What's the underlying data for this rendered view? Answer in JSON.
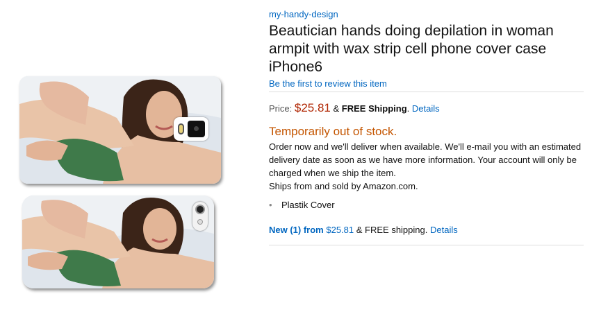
{
  "images": [
    {
      "name": "phone-case-galaxy",
      "camera": "square-camera"
    },
    {
      "name": "phone-case-iphone6",
      "camera": "round-camera"
    }
  ],
  "product": {
    "brand": "my-handy-design",
    "title": "Beautician hands doing depilation in woman armpit with wax strip cell phone cover case iPhone6",
    "review_link": "Be the first to review this item"
  },
  "price": {
    "label": "Price:",
    "value": "$25.81",
    "shipping_prefix": "&",
    "shipping": "FREE Shipping",
    "shipping_suffix": ".",
    "details_link": "Details"
  },
  "availability": {
    "status": "Temporarily out of stock.",
    "message": "Order now and we'll deliver when available. We'll e-mail you with an estimated delivery date as soon as we have more information. Your account will only be charged when we ship the item.",
    "ships_from": "Ships from and sold by Amazon.com."
  },
  "features": [
    {
      "bullet": "•",
      "text": "Plastik Cover"
    }
  ],
  "offers": {
    "label": "New (1) from",
    "price": "$25.81",
    "shipping": "& FREE shipping.",
    "details_link": "Details"
  },
  "colors": {
    "link": "#0066c0",
    "price": "#b12704",
    "stock": "#c45500"
  }
}
